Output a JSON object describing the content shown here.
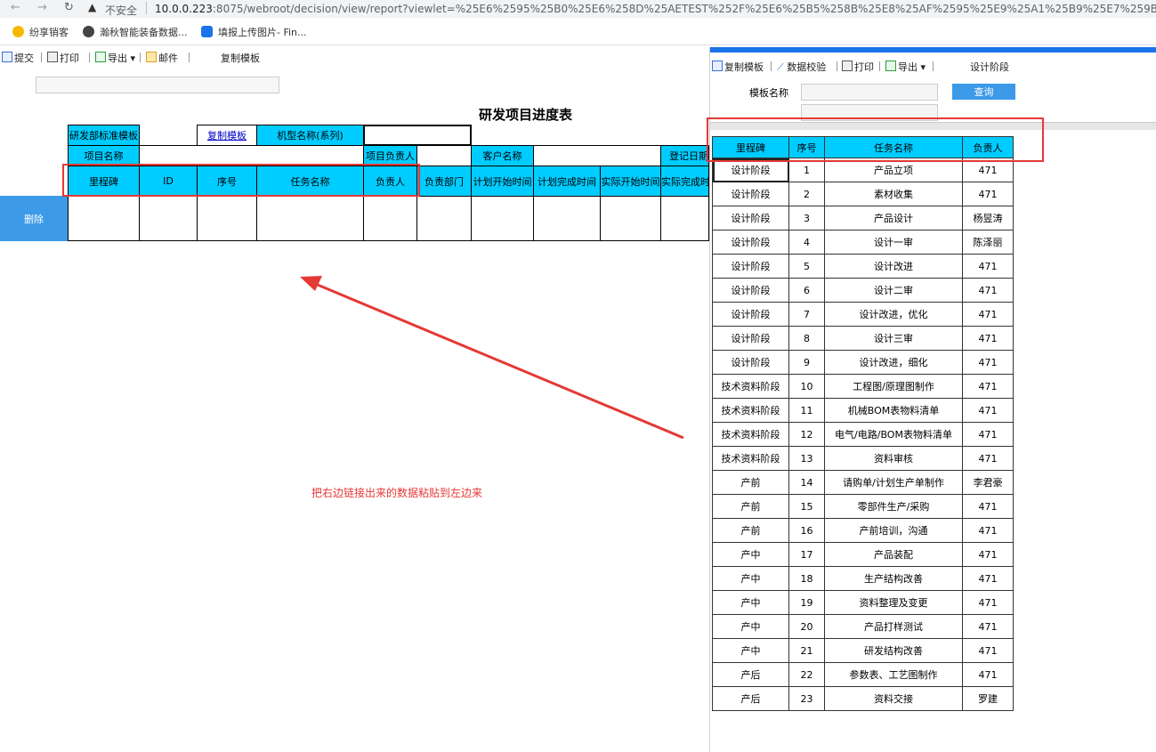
{
  "browser": {
    "insecure_label": "不安全",
    "url_host": "10.0.0.223",
    "url_path": ":8075/webroot/decision/view/report?viewlet=%25E6%2595%25B0%25E6%258D%25AETEST%252F%25E6%25B5%258B%25E8%25AF%2595%25E9%25A1%25B9%25E7%259B%25",
    "bookmarks": [
      "纷享销客",
      "瀚秋智能装备数据...",
      "填报上传图片- Fin..."
    ]
  },
  "left_toolbar": {
    "submit": "提交",
    "print": "打印",
    "export": "导出",
    "mail": "邮件",
    "copy_template": "复制模板"
  },
  "report": {
    "title": "研发项目进度表",
    "row1": {
      "template_label": "研发部标准模板",
      "copy_link": "复制模板",
      "model_label": "机型名称(系列)"
    },
    "row2": {
      "project_name": "项目名称",
      "project_owner": "项目负责人",
      "customer": "客户名称",
      "reg_date": "登记日期"
    },
    "headers": [
      "里程碑",
      "ID",
      "序号",
      "任务名称",
      "负责人",
      "负责部门",
      "计划开始时间",
      "计划完成时间",
      "实际开始时间",
      "实际完成时间"
    ],
    "delete_button": "删除"
  },
  "annotation": "把右边链接出来的数据粘贴到左边来",
  "right_panel": {
    "toolbar": {
      "copy_template": "复制模板",
      "validate": "数据校验",
      "print": "打印",
      "export": "导出",
      "stage": "设计阶段"
    },
    "template_name_label": "模板名称",
    "query_button": "查询",
    "table": {
      "headers": [
        "里程碑",
        "序号",
        "任务名称",
        "负责人"
      ],
      "rows": [
        [
          "设计阶段",
          "1",
          "产品立项",
          "471"
        ],
        [
          "设计阶段",
          "2",
          "素材收集",
          "471"
        ],
        [
          "设计阶段",
          "3",
          "产品设计",
          "杨昱涛"
        ],
        [
          "设计阶段",
          "4",
          "设计一审",
          "陈泽丽"
        ],
        [
          "设计阶段",
          "5",
          "设计改进",
          "471"
        ],
        [
          "设计阶段",
          "6",
          "设计二审",
          "471"
        ],
        [
          "设计阶段",
          "7",
          "设计改进，优化",
          "471"
        ],
        [
          "设计阶段",
          "8",
          "设计三审",
          "471"
        ],
        [
          "设计阶段",
          "9",
          "设计改进，细化",
          "471"
        ],
        [
          "技术资料阶段",
          "10",
          "工程图/原理图制作",
          "471"
        ],
        [
          "技术资料阶段",
          "11",
          "机械BOM表物料清单",
          "471"
        ],
        [
          "技术资料阶段",
          "12",
          "电气/电路/BOM表物料清单",
          "471"
        ],
        [
          "技术资料阶段",
          "13",
          "资料审核",
          "471"
        ],
        [
          "产前",
          "14",
          "请购单/计划生产单制作",
          "李君豪"
        ],
        [
          "产前",
          "15",
          "零部件生产/采购",
          "471"
        ],
        [
          "产前",
          "16",
          "产前培训，沟通",
          "471"
        ],
        [
          "产中",
          "17",
          "产品装配",
          "471"
        ],
        [
          "产中",
          "18",
          "生产结构改善",
          "471"
        ],
        [
          "产中",
          "19",
          "资料整理及变更",
          "471"
        ],
        [
          "产中",
          "20",
          "产品打样测试",
          "471"
        ],
        [
          "产中",
          "21",
          "研发结构改善",
          "471"
        ],
        [
          "产后",
          "22",
          "参数表、工艺图制作",
          "471"
        ],
        [
          "产后",
          "23",
          "资料交接",
          "罗建"
        ]
      ]
    }
  },
  "colors": {
    "header_cyan": "#00ccff",
    "button_blue": "#3c9ae8",
    "annotation_red": "#e53935"
  }
}
